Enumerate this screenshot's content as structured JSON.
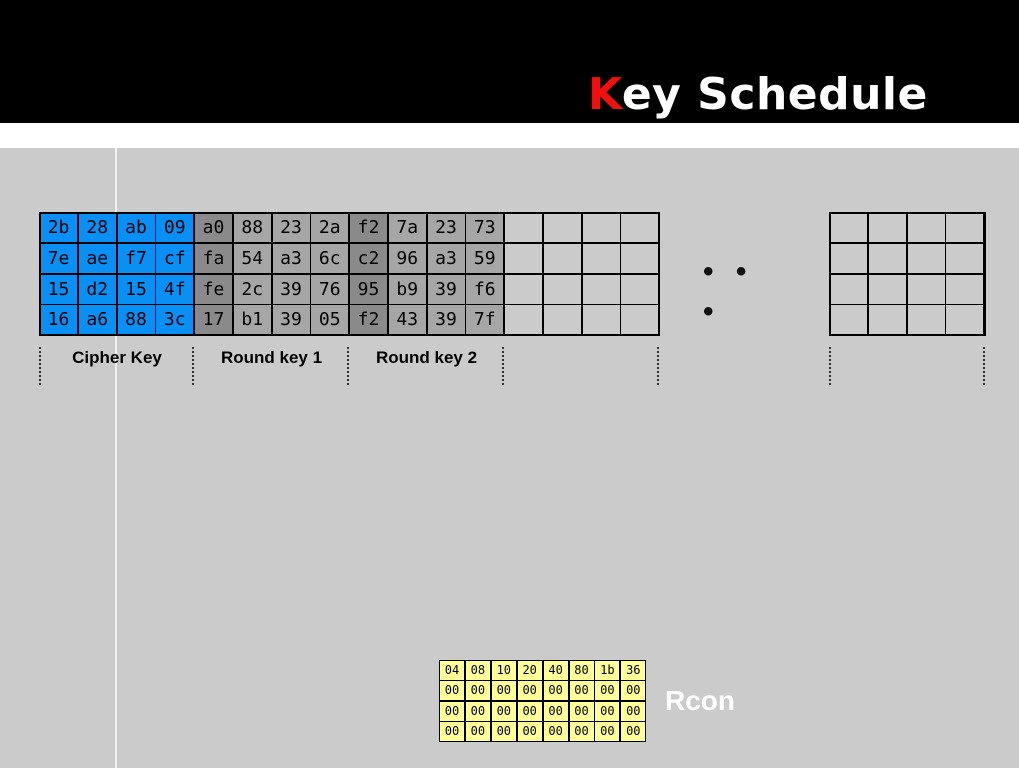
{
  "title": {
    "first_letter": "K",
    "rest": "ey Schedule"
  },
  "cipher_key": {
    "label": "Cipher Key",
    "rows": [
      [
        "2b",
        "28",
        "ab",
        "09"
      ],
      [
        "7e",
        "ae",
        "f7",
        "cf"
      ],
      [
        "15",
        "d2",
        "15",
        "4f"
      ],
      [
        "16",
        "a6",
        "88",
        "3c"
      ]
    ]
  },
  "round_key_1": {
    "label": "Round key 1",
    "rows": [
      [
        "a0",
        "88",
        "23",
        "2a"
      ],
      [
        "fa",
        "54",
        "a3",
        "6c"
      ],
      [
        "fe",
        "2c",
        "39",
        "76"
      ],
      [
        "17",
        "b1",
        "39",
        "05"
      ]
    ]
  },
  "round_key_2": {
    "label": "Round key 2",
    "rows": [
      [
        "f2",
        "7a",
        "23",
        "73"
      ],
      [
        "c2",
        "96",
        "a3",
        "59"
      ],
      [
        "95",
        "b9",
        "39",
        "f6"
      ],
      [
        "f2",
        "43",
        "39",
        "7f"
      ]
    ]
  },
  "ellipsis": "• • •",
  "rcon": {
    "label": "Rcon",
    "rows": [
      [
        "04",
        "08",
        "10",
        "20",
        "40",
        "80",
        "1b",
        "36"
      ],
      [
        "00",
        "00",
        "00",
        "00",
        "00",
        "00",
        "00",
        "00"
      ],
      [
        "00",
        "00",
        "00",
        "00",
        "00",
        "00",
        "00",
        "00"
      ],
      [
        "00",
        "00",
        "00",
        "00",
        "00",
        "00",
        "00",
        "00"
      ]
    ]
  },
  "colors": {
    "header": "#000000",
    "accent_letter": "#f01010",
    "cipher_key_fill": "#0a90f5",
    "round_key_fill_first_column": "#8a8a8a",
    "round_key_fill": "#a6a6a6",
    "rcon_fill": "#ffff99",
    "background": "#cbcbcb"
  }
}
